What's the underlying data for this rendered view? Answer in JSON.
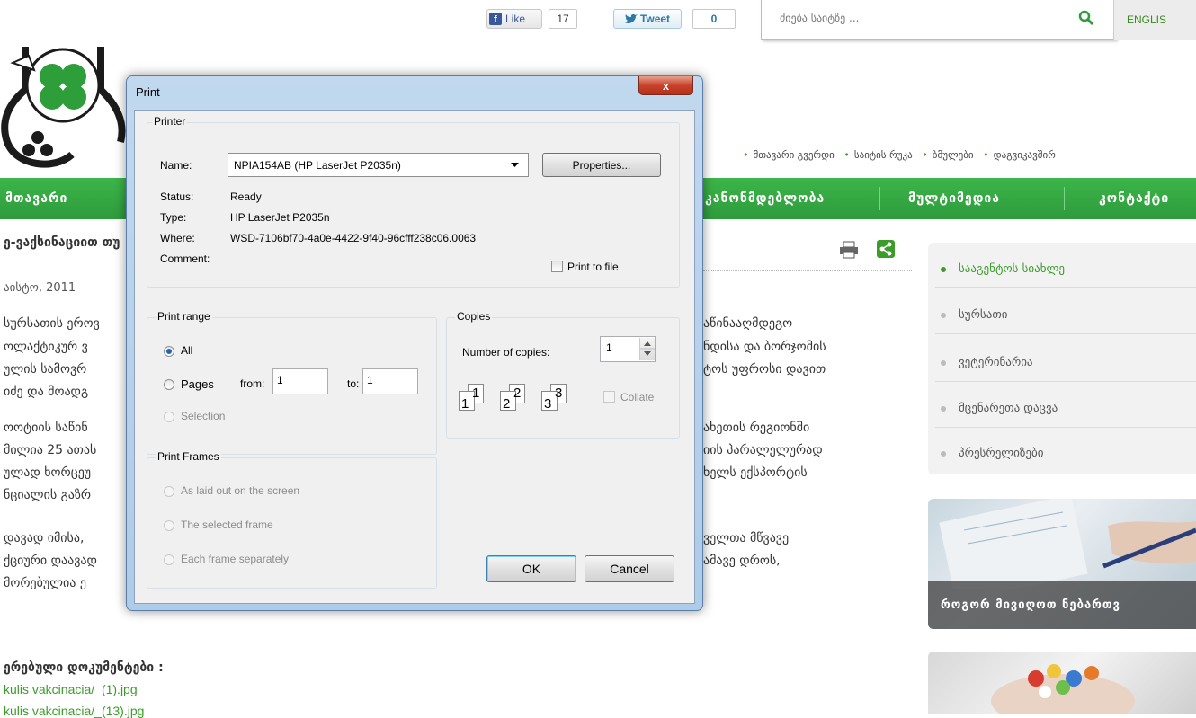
{
  "social": {
    "fb_like_label": "Like",
    "fb_count": "17",
    "tweet_label": "Tweet",
    "tweet_count": "0"
  },
  "search": {
    "placeholder": "ძიება საიტზე ..."
  },
  "lang_label": "ENGLIS",
  "topnav": [
    "მთავარი გვერდი",
    "საიტის რუკა",
    "ბმულები",
    "დაგვიკავშირ"
  ],
  "mainnav": {
    "item_home": "მთავარი",
    "item_law": "კანონმდებლობა",
    "item_multimedia": "მულტიმედია",
    "item_contact": "კონტაქტი"
  },
  "article": {
    "title": "ე-ვაქსინაციით თუ",
    "date": "აისტო, 2011",
    "left_lines": [
      "სურსათის ეროვ",
      "ოლაქტიკურ ვ",
      "ულის სამოვრ",
      "იძე და მოადგ",
      "ოოტიის საწინ",
      "მილია 25 ათას",
      "ულად ხორცეუ",
      "ნციალის გაზრ",
      "დავად იმისა,",
      "ქციური დაავად",
      "მორებულია ე"
    ],
    "right_lines": [
      "აწინააღმდეგო",
      "ნდისა და ბორჯომის",
      "ტოს უფროსი დავით",
      "ახეთის რეგიონში",
      "იის პარალელურად",
      "ხელს ექსპორტის",
      "ველთა მწვავე",
      "ამავე დროს,"
    ],
    "attachments_title": "ერებული დოკუმენტები :",
    "attachments": [
      "kulis vakcinacia/_(1).jpg",
      "kulis vakcinacia/_(13).jpg"
    ]
  },
  "sidebar": {
    "items": [
      "სააგენტოს სიახლე",
      "სურსათი",
      "ვეტერინარია",
      "მცენარეთა დაცვა",
      "პრესრელიზები"
    ],
    "promo_caption": "როგორ მივიღოთ ნებართვ"
  },
  "dialog": {
    "title": "Print",
    "close_label": "x",
    "printer_group": "Printer",
    "name_label": "Name:",
    "printer_name": "NPIA154AB (HP LaserJet P2035n)",
    "properties_label": "Properties...",
    "status_label": "Status:",
    "status_value": "Ready",
    "type_label": "Type:",
    "type_value": "HP LaserJet P2035n",
    "where_label": "Where:",
    "where_value": "WSD-7106bf70-4a0e-4422-9f40-96cfff238c06.0063",
    "comment_label": "Comment:",
    "print_to_file_label": "Print to file",
    "range_group": "Print range",
    "all_label": "All",
    "pages_label": "Pages",
    "from_label": "from:",
    "from_value": "1",
    "to_label": "to:",
    "to_value": "1",
    "selection_label": "Selection",
    "copies_group": "Copies",
    "num_copies_label": "Number of copies:",
    "num_copies_value": "1",
    "collate_label": "Collate",
    "collate_pages": [
      "1",
      "1",
      "2",
      "2",
      "3",
      "3"
    ],
    "frames_group": "Print Frames",
    "frames_options": [
      "As laid out on the screen",
      "The selected frame",
      "Each frame separately"
    ],
    "ok_label": "OK",
    "cancel_label": "Cancel"
  },
  "colors": {
    "brand_green": "#34a843",
    "dialog_frame": "#aecbe7",
    "close_red": "#c8432b"
  }
}
